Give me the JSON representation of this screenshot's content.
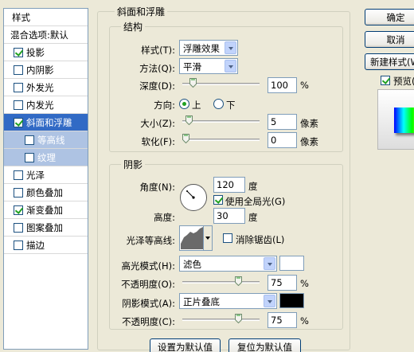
{
  "sidebar": {
    "header": "样式",
    "blend": "混合选项:默认",
    "items": [
      {
        "label": "投影",
        "checked": true
      },
      {
        "label": "内阴影",
        "checked": false
      },
      {
        "label": "外发光",
        "checked": false
      },
      {
        "label": "内发光",
        "checked": false
      },
      {
        "label": "斜面和浮雕",
        "checked": true
      },
      {
        "label": "等高线",
        "checked": false
      },
      {
        "label": "纹理",
        "checked": false
      },
      {
        "label": "光泽",
        "checked": false
      },
      {
        "label": "颜色叠加",
        "checked": false
      },
      {
        "label": "渐变叠加",
        "checked": true
      },
      {
        "label": "图案叠加",
        "checked": false
      },
      {
        "label": "描边",
        "checked": false
      }
    ]
  },
  "panel": {
    "title": "斜面和浮雕",
    "structure": {
      "title": "结构",
      "style_label": "样式(T):",
      "style_value": "浮雕效果",
      "technique_label": "方法(Q):",
      "technique_value": "平滑",
      "depth_label": "深度(D):",
      "depth_value": "100",
      "depth_unit": "%",
      "direction_label": "方向:",
      "dir_up": "上",
      "dir_down": "下",
      "size_label": "大小(Z):",
      "size_value": "5",
      "size_unit": "像素",
      "soften_label": "软化(F):",
      "soften_value": "0",
      "soften_unit": "像素"
    },
    "shading": {
      "title": "阴影",
      "angle_label": "角度(N):",
      "angle_value": "120",
      "angle_unit": "度",
      "global_light_label": "使用全局光(G)",
      "altitude_label": "高度:",
      "altitude_value": "30",
      "altitude_unit": "度",
      "gloss_label": "光泽等高线:",
      "antialias_label": "消除锯齿(L)",
      "highlight_label": "高光模式(H):",
      "highlight_value": "滤色",
      "highlight_color": "#ffffff",
      "hl_opacity_label": "不透明度(O):",
      "hl_opacity_value": "75",
      "hl_opacity_unit": "%",
      "shadow_label": "阴影模式(A):",
      "shadow_value": "正片叠底",
      "shadow_color": "#000000",
      "sh_opacity_label": "不透明度(C):",
      "sh_opacity_value": "75",
      "sh_opacity_unit": "%"
    },
    "make_default": "设置为默认值",
    "reset_default": "复位为默认值"
  },
  "right": {
    "ok": "确定",
    "cancel": "取消",
    "new_style": "新建样式(W)...",
    "preview_label": "预览(V)"
  },
  "levels": {
    "depth": 0.1,
    "size": 0.05,
    "soften": 0.0,
    "hl_opacity": 0.75,
    "sh_opacity": 0.75
  }
}
